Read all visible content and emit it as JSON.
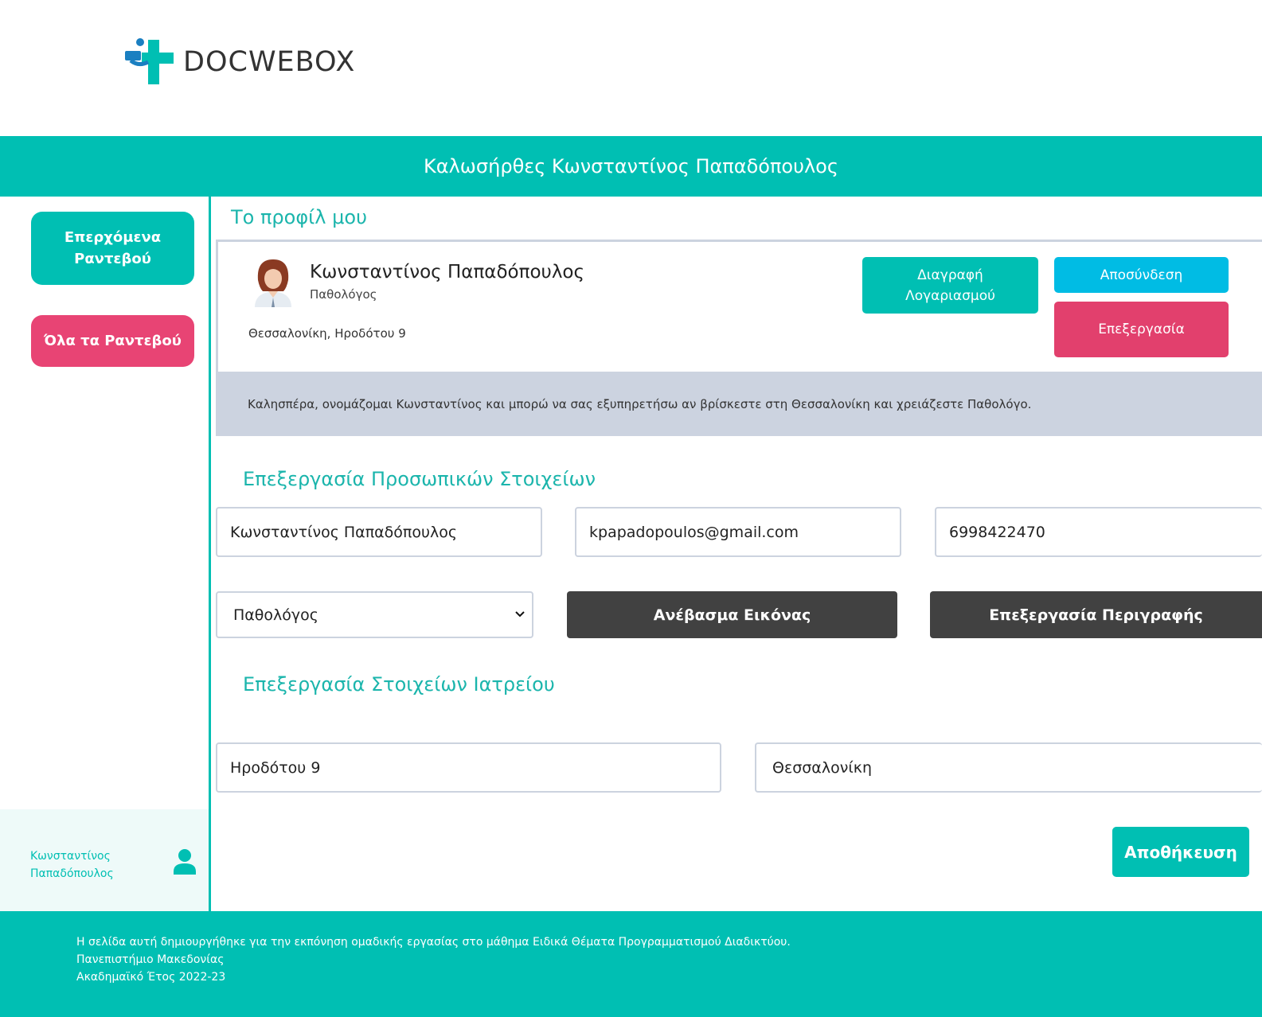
{
  "brand": {
    "name": "DOCWEBOX"
  },
  "colors": {
    "primary": "#00bfb3",
    "accent_pink": "#e84474",
    "accent_blue": "#00bce4",
    "dark": "#414141",
    "card_border": "#ccd3df"
  },
  "header": {
    "welcome": "Καλωσήρθες Κωνσταντίνος Παπαδόπουλος"
  },
  "sidebar": {
    "upcoming_label": "Επερχόμενα Ραντεβού",
    "all_label": "Όλα τα Ραντεβού",
    "user_name": "Κωνσταντίνος Παπαδόπουλος",
    "user_icon": "user-icon"
  },
  "profile": {
    "section_title": "Το προφίλ μου",
    "name": "Κωνσταντίνος Παπαδόπουλος",
    "specialty": "Παθολόγος",
    "address": "Θεσσαλονίκη, Ηροδότου 9",
    "delete_label": "Διαγραφή Λογαριασμού",
    "logout_label": "Αποσύνδεση",
    "edit_label": "Επεξεργασία",
    "description": "Καλησπέρα, ονομάζομαι Κωνσταντίνος και μπορώ να σας εξυπηρετήσω αν βρίσκεστε στη Θεσσαλονίκη και χρειάζεστε Παθολόγο."
  },
  "personal": {
    "section_title": "Επεξεργασία Προσωπικών Στοιχείων",
    "name_value": "Κωνσταντίνος Παπαδόπουλος",
    "email_value": "kpapadopoulos@gmail.com",
    "phone_value": "6998422470",
    "specialty_selected": "Παθολόγος",
    "upload_label": "Ανέβασμα Εικόνας",
    "edit_desc_label": "Επεξεργασία Περιγραφής"
  },
  "clinic": {
    "section_title": "Επεξεργασία Στοιχείων Ιατρείου",
    "street_value": "Ηροδότου 9",
    "city_selected": "Θεσσαλονίκη",
    "save_label": "Αποθήκευση"
  },
  "footer": {
    "line1": "Η σελίδα αυτή δημιουργήθηκε για την εκπόνηση ομαδικής εργασίας στο μάθημα Ειδικά Θέματα Προγραμματισμού Διαδικτύου.",
    "line2": "Πανεπιστήμιο Μακεδονίας",
    "line3": "Ακαδημαϊκό Έτος 2022-23"
  }
}
